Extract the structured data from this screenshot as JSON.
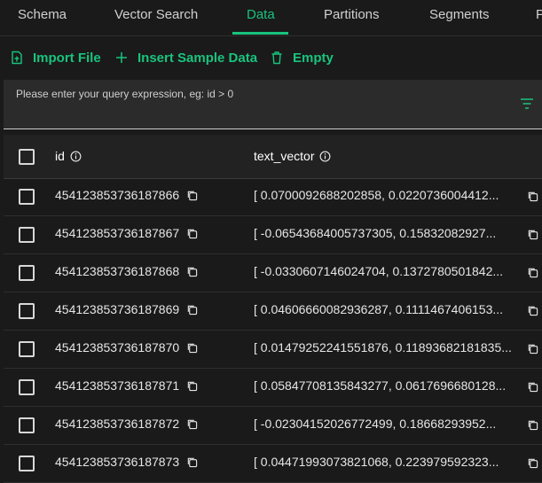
{
  "tabs": [
    {
      "label": "Schema"
    },
    {
      "label": "Vector Search"
    },
    {
      "label": "Data",
      "active": true
    },
    {
      "label": "Partitions"
    },
    {
      "label": "Segments"
    },
    {
      "label": "P"
    }
  ],
  "toolbar": {
    "import_label": "Import File",
    "insert_label": "Insert Sample Data",
    "empty_label": "Empty"
  },
  "query": {
    "placeholder": "Please enter your query expression, eg: id > 0"
  },
  "table": {
    "columns": [
      {
        "label": "id"
      },
      {
        "label": "text_vector"
      }
    ],
    "rows": [
      {
        "id": "454123853736187866",
        "vector": "[ 0.0700092688202858, 0.0220736004412..."
      },
      {
        "id": "454123853736187867",
        "vector": "[ -0.06543684005737305, 0.15832082927..."
      },
      {
        "id": "454123853736187868",
        "vector": "[ -0.0330607146024704, 0.1372780501842..."
      },
      {
        "id": "454123853736187869",
        "vector": "[ 0.04606660082936287, 0.1111467406153..."
      },
      {
        "id": "454123853736187870",
        "vector": "[ 0.01479252241551876, 0.11893682181835..."
      },
      {
        "id": "454123853736187871",
        "vector": "[ 0.05847708135843277, 0.0617696680128..."
      },
      {
        "id": "454123853736187872",
        "vector": "[ -0.02304152026772499, 0.18668293952..."
      },
      {
        "id": "454123853736187873",
        "vector": "[ 0.04471993073821068, 0.223979592323..."
      }
    ]
  },
  "colors": {
    "accent": "#19c37d",
    "background": "#1a1a1a"
  }
}
